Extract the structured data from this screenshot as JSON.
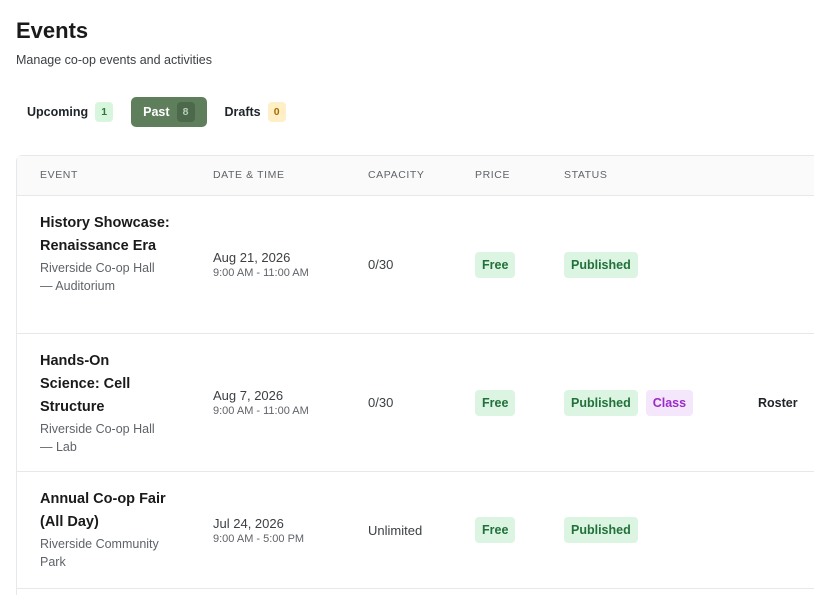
{
  "header": {
    "title": "Events",
    "subtitle": "Manage co-op events and activities"
  },
  "tabs": [
    {
      "label": "Upcoming",
      "count": "1",
      "active": false,
      "count_color": "#d8f5dd"
    },
    {
      "label": "Past",
      "count": "8",
      "active": true,
      "count_color": "#4c6a4b"
    },
    {
      "label": "Drafts",
      "count": "0",
      "active": false,
      "count_color": "#feefc6"
    }
  ],
  "colors": {
    "accent": "#5e7e5c",
    "status_green_bg": "#dcf5e2",
    "status_green_text": "#22703a",
    "class_purple_bg": "#f4e6fb",
    "class_purple_text": "#9a2bc9"
  },
  "table": {
    "columns": [
      "EVENT",
      "DATE & TIME",
      "CAPACITY",
      "PRICE",
      "STATUS"
    ],
    "rows": [
      {
        "title": "History Showcase: Renaissance Era",
        "location": "Riverside Co-op Hall — Auditorium",
        "date": "Aug 21, 2026",
        "time": "9:00 AM - 11:00 AM",
        "capacity": "0/30",
        "price": "Free",
        "status": "Published"
      },
      {
        "title": "Hands-On Science: Cell Structure",
        "location": "Riverside Co-op Hall — Lab",
        "date": "Aug 7, 2026",
        "time": "9:00 AM - 11:00 AM",
        "capacity": "0/30",
        "price": "Free",
        "status": "Published",
        "type_badge": "Class",
        "action": "Roster"
      },
      {
        "title": "Annual Co-op Fair (All Day)",
        "location": "Riverside Community Park",
        "date": "Jul 24, 2026",
        "time": "9:00 AM - 5:00 PM",
        "capacity": "Unlimited",
        "price": "Free",
        "status": "Published"
      }
    ]
  }
}
